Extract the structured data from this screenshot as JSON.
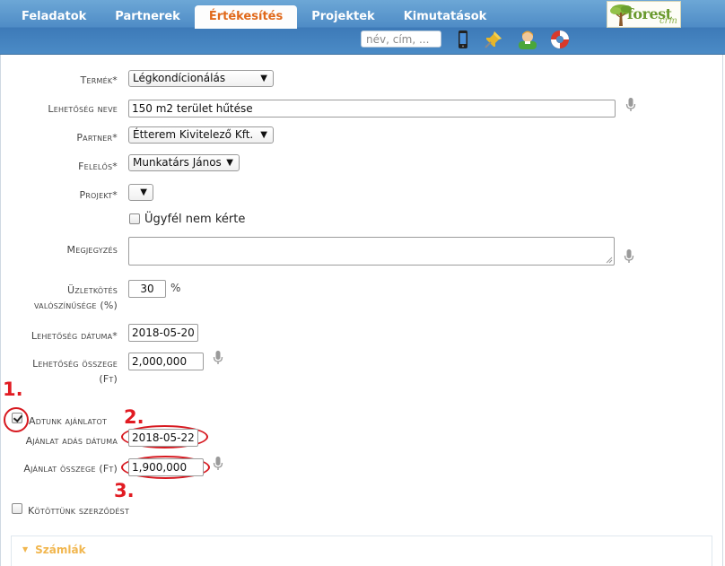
{
  "nav": {
    "tabs": [
      {
        "label": "Feladatok"
      },
      {
        "label": "Partnerek"
      },
      {
        "label": "Értékesítés"
      },
      {
        "label": "Projektek"
      },
      {
        "label": "Kimutatások"
      }
    ],
    "active_tab": "Értékesítés",
    "search_placeholder": "név, cím, ...",
    "logo": {
      "text": "forest",
      "sub": "crm"
    }
  },
  "form": {
    "termek": {
      "label": "Termék",
      "req": "*",
      "value": "Légkondícionálás"
    },
    "lehetoseg_neve": {
      "label": "Lehetőség neve",
      "value": "150 m2 terület hűtése"
    },
    "partner": {
      "label": "Partner",
      "req": "*",
      "value": "Étterem Kivitelező Kft."
    },
    "felelos": {
      "label": "Felelős",
      "req": "*",
      "value": "Munkatárs János"
    },
    "projekt": {
      "label": "Projekt",
      "req": "*",
      "value": ""
    },
    "ugyfel_nem_kerte": {
      "label": "Ügyfél nem kérte",
      "checked": false
    },
    "megjegyzes": {
      "label": "Megjegyzés",
      "value": ""
    },
    "uzletkotes": {
      "label_line1": "Üzletkötés",
      "label_line2": "valószínűsége (%)",
      "value": "30",
      "unit": "%"
    },
    "lehetoseg_datuma": {
      "label": "Lehetőség dátuma",
      "req": "*",
      "value": "2018-05-20"
    },
    "lehetoseg_osszege": {
      "label_line1": "Lehetőség összege",
      "label_line2": "(Ft)",
      "value": "2,000,000"
    },
    "adtunk_ajanlatot": {
      "label": "Adtunk ajánlatot",
      "checked": true
    },
    "ajanlat_adas_datuma": {
      "label": "Ajánlat adás dátuma",
      "value": "2018-05-22"
    },
    "ajanlat_osszege": {
      "label": "Ajánlat összege (Ft)",
      "value": "1,900,000"
    },
    "kotottunk_szerzodest": {
      "label": "Kötöttünk szerződést",
      "checked": false
    }
  },
  "annotations": {
    "n1": "1.",
    "n2": "2.",
    "n3": "3."
  },
  "sections": {
    "szamlak": {
      "title": "Számlák"
    }
  },
  "colors": {
    "accent": "#e0691b",
    "annotation": "#d71920",
    "nav_bg": "#4f8cc6",
    "section_title": "#f1b64e"
  }
}
